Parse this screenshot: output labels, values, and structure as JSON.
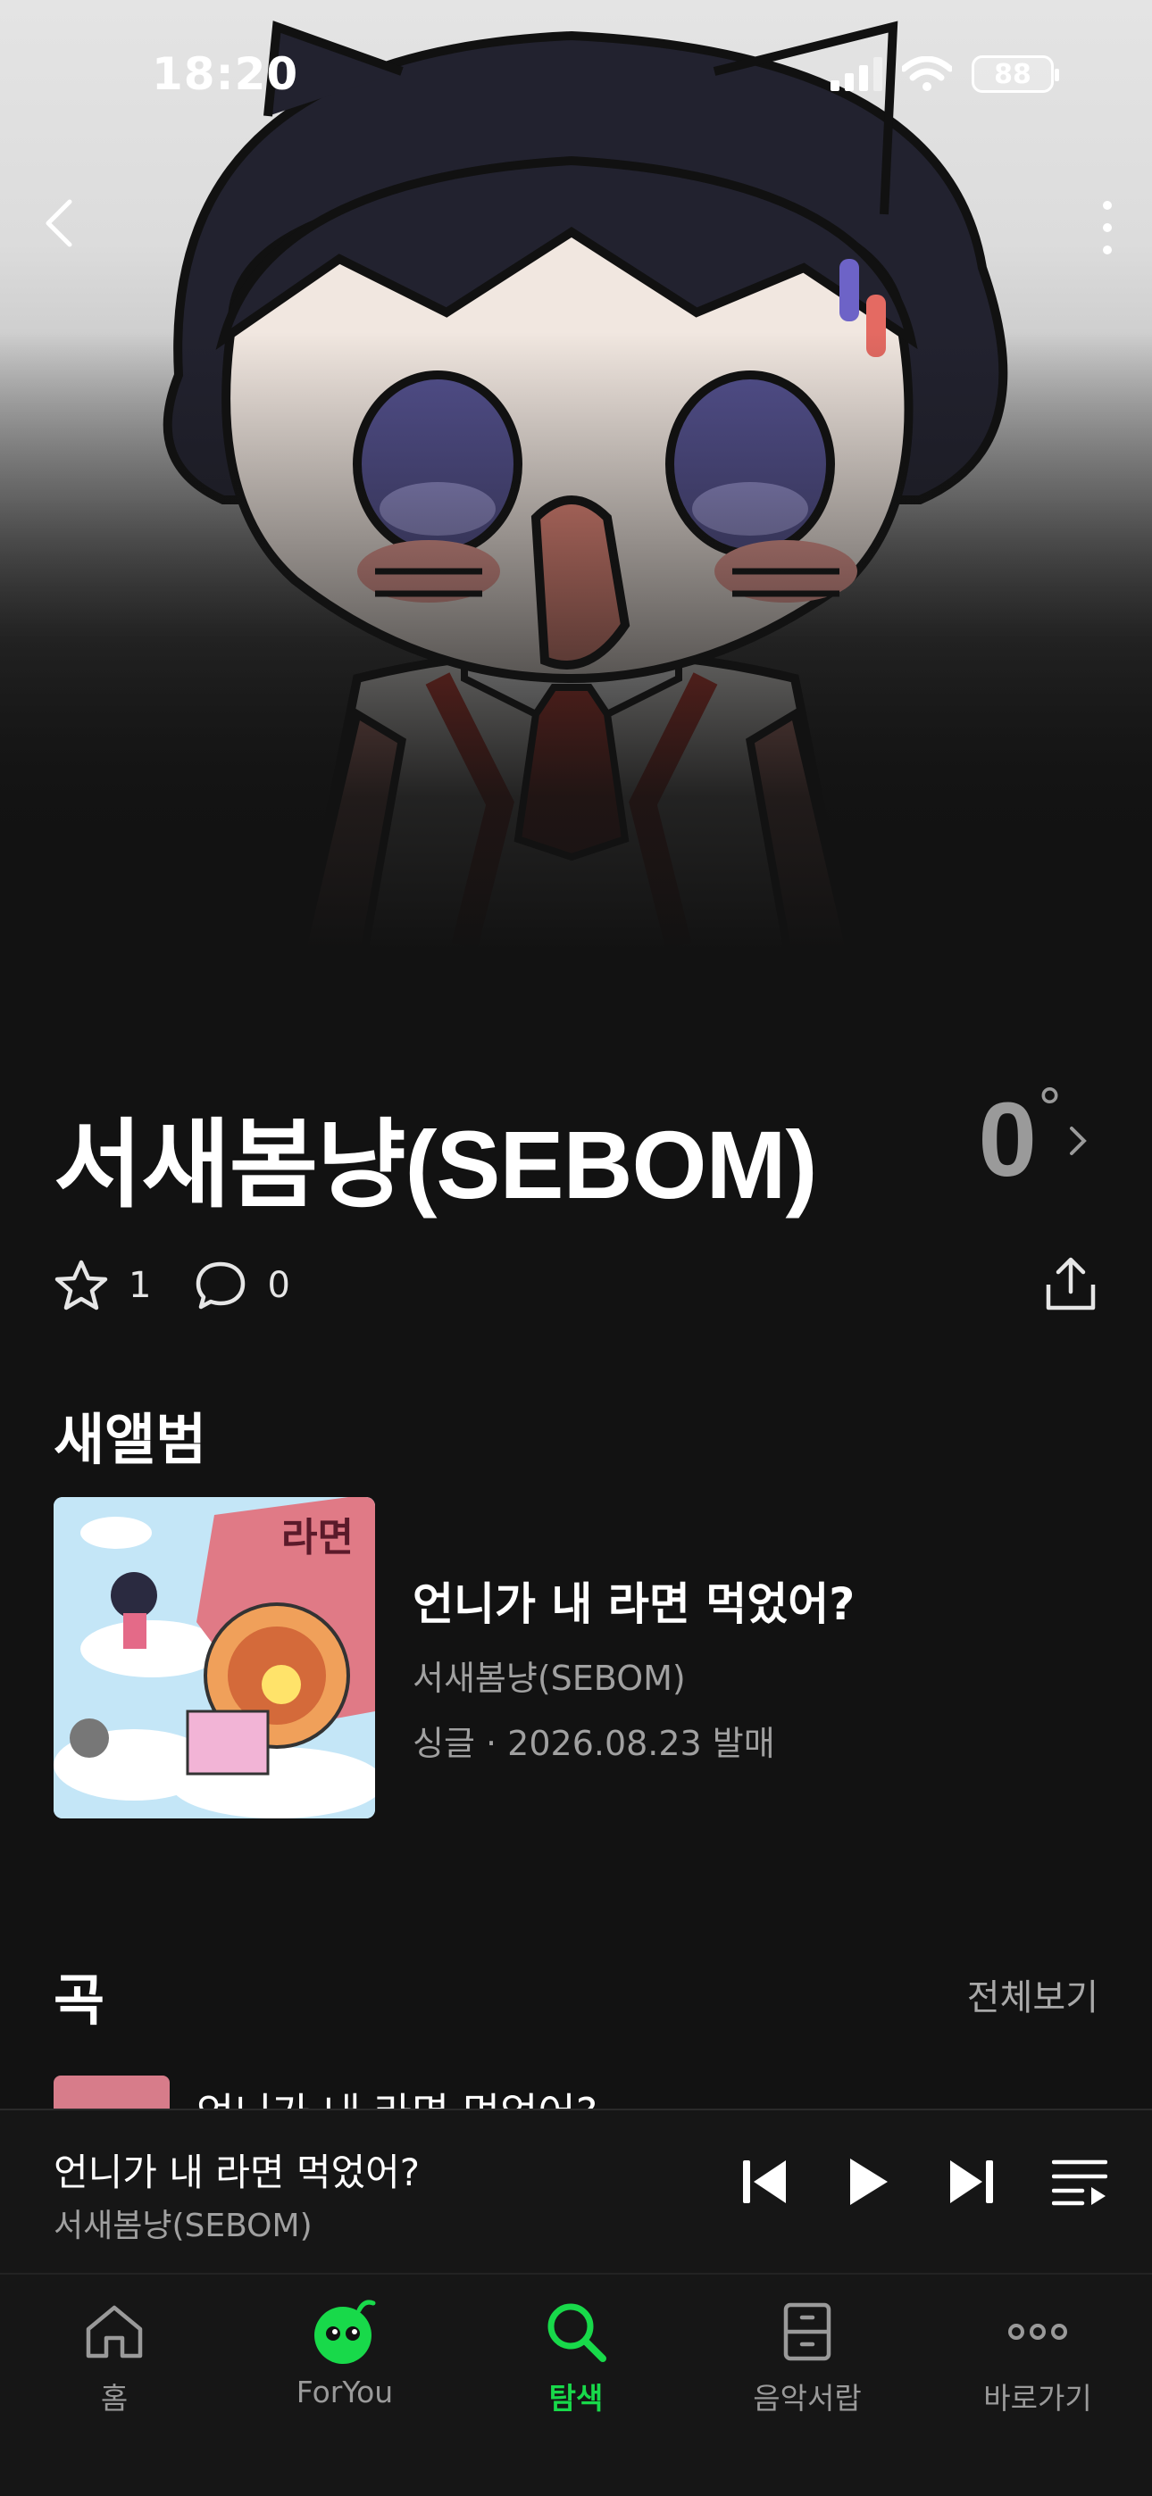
{
  "status_bar": {
    "time": "18:20",
    "battery": "88"
  },
  "artist": {
    "name": "서새봄냥(SEBOM)",
    "temperature": "0",
    "temperature_unit": "°",
    "likes": "1",
    "comments": "0"
  },
  "new_album": {
    "section_title": "새앨범",
    "title": "언니가 내 라면 먹었어?",
    "artist": "서새봄냥(SEBOM)",
    "meta": "싱글 · 2026.08.23 발매",
    "cover_text": "라면"
  },
  "songs": {
    "section_title": "곡",
    "see_all": "전체보기",
    "first_song_title": "언니가 내 라면 먹었어?"
  },
  "mini_player": {
    "title": "언니가 내 라면 먹었어?",
    "artist": "서새봄냥(SEBOM)"
  },
  "tabs": [
    {
      "label": "홈",
      "icon": "home-icon"
    },
    {
      "label": "ForYou",
      "icon": "foryou-character-icon"
    },
    {
      "label": "탐색",
      "icon": "search-icon",
      "active": true
    },
    {
      "label": "음악서랍",
      "icon": "drawer-icon"
    },
    {
      "label": "바로가기",
      "icon": "more-dots-icon"
    }
  ],
  "colors": {
    "accent": "#18d94a",
    "background": "#121212",
    "secondary_text": "#a0a0a0"
  }
}
